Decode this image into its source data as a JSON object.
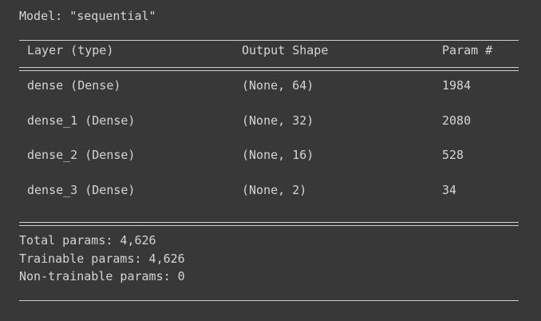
{
  "model_title": "Model: \"sequential\"",
  "table": {
    "headers": [
      "Layer (type)",
      "Output Shape",
      "Param #"
    ],
    "rows": [
      {
        "layer": "dense (Dense)",
        "shape": "(None, 64)",
        "params": "1984"
      },
      {
        "layer": "dense_1 (Dense)",
        "shape": "(None, 32)",
        "params": "2080"
      },
      {
        "layer": "dense_2 (Dense)",
        "shape": "(None, 16)",
        "params": "528"
      },
      {
        "layer": "dense_3 (Dense)",
        "shape": "(None, 2)",
        "params": "34"
      }
    ]
  },
  "summary": {
    "total": "Total params: 4,626",
    "trainable": "Trainable params: 4,626",
    "non_trainable": "Non-trainable params: 0"
  }
}
